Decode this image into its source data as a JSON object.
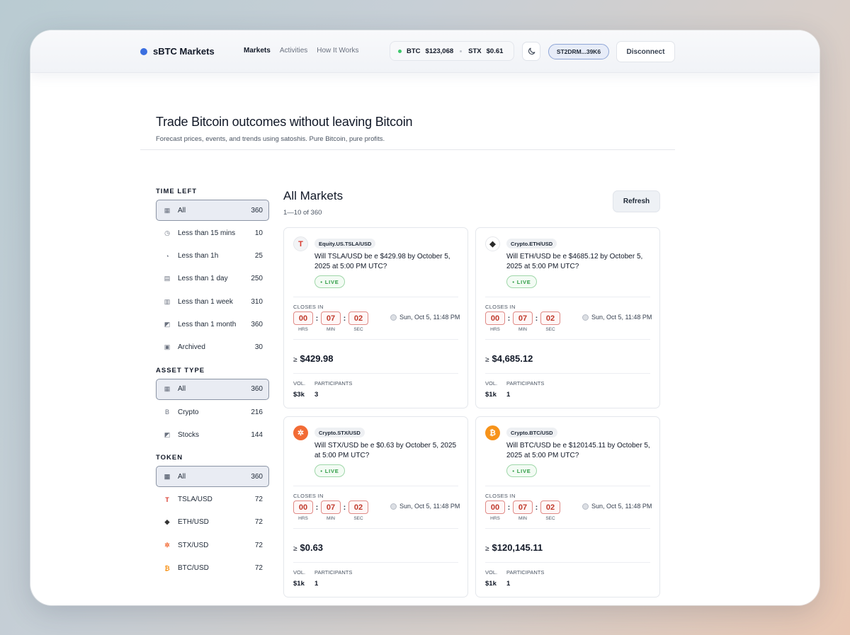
{
  "header": {
    "brand": "sBTC Markets",
    "nav": [
      "Markets",
      "Activities",
      "How It Works"
    ],
    "ticker": {
      "btc_label": "BTC",
      "btc_price": "$123,068",
      "stx_label": "STX",
      "stx_price": "$0.61"
    },
    "address": "ST2DRM...39K6",
    "disconnect": "Disconnect"
  },
  "hero": {
    "title": "Trade Bitcoin outcomes without leaving Bitcoin",
    "subtitle": "Forecast prices, events, and trends using satoshis. Pure Bitcoin, pure profits."
  },
  "filters": {
    "time_left": {
      "title": "TIME LEFT",
      "items": [
        {
          "icon": "▦",
          "label": "All",
          "count": "360"
        },
        {
          "icon": "◷",
          "label": "Less than 15 mins",
          "count": "10"
        },
        {
          "icon": "◔",
          "label": "Less than 1h",
          "count": "25"
        },
        {
          "icon": "▤",
          "label": "Less than 1 day",
          "count": "250"
        },
        {
          "icon": "▥",
          "label": "Less than 1 week",
          "count": "310"
        },
        {
          "icon": "◩",
          "label": "Less than 1 month",
          "count": "360"
        },
        {
          "icon": "▣",
          "label": "Archived",
          "count": "30"
        }
      ]
    },
    "asset_type": {
      "title": "ASSET TYPE",
      "items": [
        {
          "icon": "▦",
          "label": "All",
          "count": "360"
        },
        {
          "icon": "B",
          "label": "Crypto",
          "count": "216"
        },
        {
          "icon": "◩",
          "label": "Stocks",
          "count": "144"
        }
      ]
    },
    "token": {
      "title": "TOKEN",
      "items": [
        {
          "icon": "▦",
          "label": "All",
          "count": "360"
        },
        {
          "icon": "T",
          "label": "TSLA/USD",
          "count": "72"
        },
        {
          "icon": "◆",
          "label": "ETH/USD",
          "count": "72"
        },
        {
          "icon": "✲",
          "label": "STX/USD",
          "count": "72"
        },
        {
          "icon": "₿",
          "label": "BTC/USD",
          "count": "72"
        }
      ]
    }
  },
  "markets": {
    "title": "All Markets",
    "range": "1—10 of 360",
    "refresh": "Refresh",
    "cards": [
      {
        "logo": "T",
        "logo_color": "#d83a2e",
        "logo_bg": "#f3f4f6",
        "tag": "Equity.US.TSLA/USD",
        "question": "Will TSLA/USD be e $429.98 by October 5, 2025 at 5:00 PM UTC?",
        "live": "• LIVE",
        "closes": "CLOSES IN",
        "hrs": "00",
        "min": "07",
        "sec": "02",
        "hrs_label": "HRS",
        "min_label": "MIN",
        "sec_label": "SEC",
        "date": "Sun, Oct 5, 11:48 PM",
        "price_prefix": "≥",
        "price": "$429.98",
        "vol_label": "VOL.",
        "vol": "$3k",
        "participants_label": "PARTICIPANTS",
        "participants": "3"
      },
      {
        "logo": "◆",
        "logo_color": "#2b2b2b",
        "logo_bg": "#ffffff",
        "tag": "Crypto.ETH/USD",
        "question": "Will ETH/USD be e $4685.12 by October 5, 2025 at 5:00 PM UTC?",
        "live": "• LIVE",
        "closes": "CLOSES IN",
        "hrs": "00",
        "min": "07",
        "sec": "02",
        "hrs_label": "HRS",
        "min_label": "MIN",
        "sec_label": "SEC",
        "date": "Sun, Oct 5, 11:48 PM",
        "price_prefix": "≥",
        "price": "$4,685.12",
        "vol_label": "VOL.",
        "vol": "$1k",
        "participants_label": "PARTICIPANTS",
        "participants": "1"
      },
      {
        "logo": "✲",
        "logo_color": "#ffffff",
        "logo_bg": "#f26b35",
        "tag": "Crypto.STX/USD",
        "question": "Will STX/USD be e $0.63 by October 5, 2025 at 5:00 PM UTC?",
        "live": "• LIVE",
        "closes": "CLOSES IN",
        "hrs": "00",
        "min": "07",
        "sec": "02",
        "hrs_label": "HRS",
        "min_label": "MIN",
        "sec_label": "SEC",
        "date": "Sun, Oct 5, 11:48 PM",
        "price_prefix": "≥",
        "price": "$0.63",
        "vol_label": "VOL.",
        "vol": "$1k",
        "participants_label": "PARTICIPANTS",
        "participants": "1"
      },
      {
        "logo": "₿",
        "logo_color": "#ffffff",
        "logo_bg": "#f7931a",
        "tag": "Crypto.BTC/USD",
        "question": "Will BTC/USD be e $120145.11 by October 5, 2025 at 5:00 PM UTC?",
        "live": "• LIVE",
        "closes": "CLOSES IN",
        "hrs": "00",
        "min": "07",
        "sec": "02",
        "hrs_label": "HRS",
        "min_label": "MIN",
        "sec_label": "SEC",
        "date": "Sun, Oct 5, 11:48 PM",
        "price_prefix": "≥",
        "price": "$120,145.11",
        "vol_label": "VOL.",
        "vol": "$1k",
        "participants_label": "PARTICIPANTS",
        "participants": "1"
      }
    ]
  }
}
